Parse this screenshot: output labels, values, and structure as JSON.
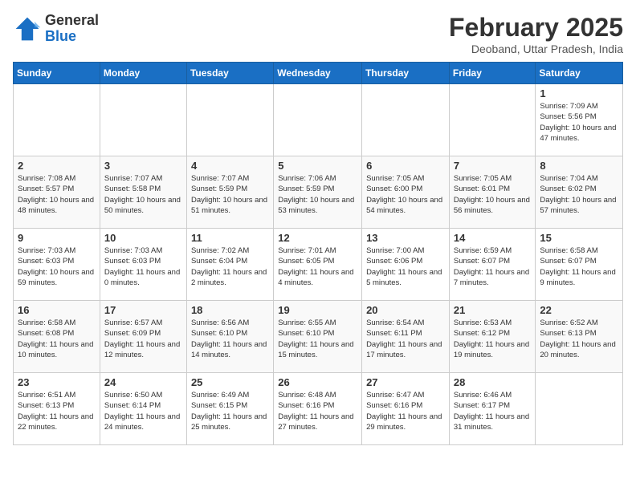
{
  "header": {
    "logo_general": "General",
    "logo_blue": "Blue",
    "title": "February 2025",
    "subtitle": "Deoband, Uttar Pradesh, India"
  },
  "days_of_week": [
    "Sunday",
    "Monday",
    "Tuesday",
    "Wednesday",
    "Thursday",
    "Friday",
    "Saturday"
  ],
  "weeks": [
    [
      {
        "day": "",
        "info": ""
      },
      {
        "day": "",
        "info": ""
      },
      {
        "day": "",
        "info": ""
      },
      {
        "day": "",
        "info": ""
      },
      {
        "day": "",
        "info": ""
      },
      {
        "day": "",
        "info": ""
      },
      {
        "day": "1",
        "info": "Sunrise: 7:09 AM\nSunset: 5:56 PM\nDaylight: 10 hours and 47 minutes."
      }
    ],
    [
      {
        "day": "2",
        "info": "Sunrise: 7:08 AM\nSunset: 5:57 PM\nDaylight: 10 hours and 48 minutes."
      },
      {
        "day": "3",
        "info": "Sunrise: 7:07 AM\nSunset: 5:58 PM\nDaylight: 10 hours and 50 minutes."
      },
      {
        "day": "4",
        "info": "Sunrise: 7:07 AM\nSunset: 5:59 PM\nDaylight: 10 hours and 51 minutes."
      },
      {
        "day": "5",
        "info": "Sunrise: 7:06 AM\nSunset: 5:59 PM\nDaylight: 10 hours and 53 minutes."
      },
      {
        "day": "6",
        "info": "Sunrise: 7:05 AM\nSunset: 6:00 PM\nDaylight: 10 hours and 54 minutes."
      },
      {
        "day": "7",
        "info": "Sunrise: 7:05 AM\nSunset: 6:01 PM\nDaylight: 10 hours and 56 minutes."
      },
      {
        "day": "8",
        "info": "Sunrise: 7:04 AM\nSunset: 6:02 PM\nDaylight: 10 hours and 57 minutes."
      }
    ],
    [
      {
        "day": "9",
        "info": "Sunrise: 7:03 AM\nSunset: 6:03 PM\nDaylight: 10 hours and 59 minutes."
      },
      {
        "day": "10",
        "info": "Sunrise: 7:03 AM\nSunset: 6:03 PM\nDaylight: 11 hours and 0 minutes."
      },
      {
        "day": "11",
        "info": "Sunrise: 7:02 AM\nSunset: 6:04 PM\nDaylight: 11 hours and 2 minutes."
      },
      {
        "day": "12",
        "info": "Sunrise: 7:01 AM\nSunset: 6:05 PM\nDaylight: 11 hours and 4 minutes."
      },
      {
        "day": "13",
        "info": "Sunrise: 7:00 AM\nSunset: 6:06 PM\nDaylight: 11 hours and 5 minutes."
      },
      {
        "day": "14",
        "info": "Sunrise: 6:59 AM\nSunset: 6:07 PM\nDaylight: 11 hours and 7 minutes."
      },
      {
        "day": "15",
        "info": "Sunrise: 6:58 AM\nSunset: 6:07 PM\nDaylight: 11 hours and 9 minutes."
      }
    ],
    [
      {
        "day": "16",
        "info": "Sunrise: 6:58 AM\nSunset: 6:08 PM\nDaylight: 11 hours and 10 minutes."
      },
      {
        "day": "17",
        "info": "Sunrise: 6:57 AM\nSunset: 6:09 PM\nDaylight: 11 hours and 12 minutes."
      },
      {
        "day": "18",
        "info": "Sunrise: 6:56 AM\nSunset: 6:10 PM\nDaylight: 11 hours and 14 minutes."
      },
      {
        "day": "19",
        "info": "Sunrise: 6:55 AM\nSunset: 6:10 PM\nDaylight: 11 hours and 15 minutes."
      },
      {
        "day": "20",
        "info": "Sunrise: 6:54 AM\nSunset: 6:11 PM\nDaylight: 11 hours and 17 minutes."
      },
      {
        "day": "21",
        "info": "Sunrise: 6:53 AM\nSunset: 6:12 PM\nDaylight: 11 hours and 19 minutes."
      },
      {
        "day": "22",
        "info": "Sunrise: 6:52 AM\nSunset: 6:13 PM\nDaylight: 11 hours and 20 minutes."
      }
    ],
    [
      {
        "day": "23",
        "info": "Sunrise: 6:51 AM\nSunset: 6:13 PM\nDaylight: 11 hours and 22 minutes."
      },
      {
        "day": "24",
        "info": "Sunrise: 6:50 AM\nSunset: 6:14 PM\nDaylight: 11 hours and 24 minutes."
      },
      {
        "day": "25",
        "info": "Sunrise: 6:49 AM\nSunset: 6:15 PM\nDaylight: 11 hours and 25 minutes."
      },
      {
        "day": "26",
        "info": "Sunrise: 6:48 AM\nSunset: 6:16 PM\nDaylight: 11 hours and 27 minutes."
      },
      {
        "day": "27",
        "info": "Sunrise: 6:47 AM\nSunset: 6:16 PM\nDaylight: 11 hours and 29 minutes."
      },
      {
        "day": "28",
        "info": "Sunrise: 6:46 AM\nSunset: 6:17 PM\nDaylight: 11 hours and 31 minutes."
      },
      {
        "day": "",
        "info": ""
      }
    ]
  ]
}
